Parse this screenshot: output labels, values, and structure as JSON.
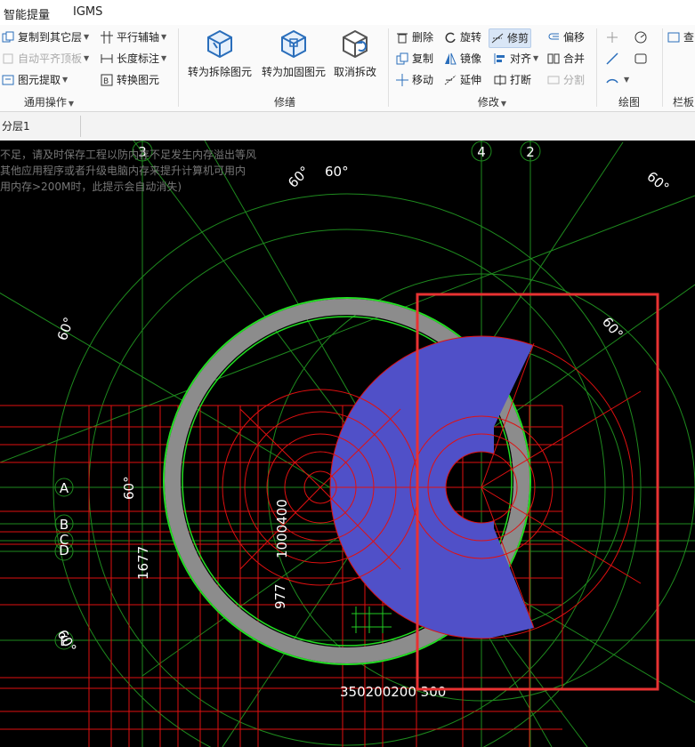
{
  "menubar": {
    "items": [
      "智能提量",
      "IGMS"
    ]
  },
  "ribbon": {
    "general": {
      "copy_to_layer": "复制到其它层",
      "auto_align_top": "自动平齐顶板",
      "element_extract": "图元提取",
      "parallel_axis": "平行辅轴",
      "length_annotation": "长度标注",
      "convert_element": "转换图元",
      "group_label": "通用操作"
    },
    "repair": {
      "to_split_element": "转为拆除图元",
      "to_reinforce_element": "转为加固图元",
      "cancel_split": "取消拆改",
      "group_label": "修缮"
    },
    "modify": {
      "delete": "删除",
      "rotate": "旋转",
      "trim": "修剪",
      "offset": "偏移",
      "copy": "复制",
      "mirror": "镜像",
      "align": "对齐",
      "merge": "合并",
      "move": "移动",
      "extend": "延伸",
      "break": "打断",
      "split": "分割",
      "group_label": "修改"
    },
    "draw": {
      "group_label": "绘图"
    },
    "panel": {
      "label": "栏板",
      "query_label": "查"
    }
  },
  "layer": {
    "current": "分层1"
  },
  "canvas": {
    "warning_lines": [
      "不足，请及时保存工程以防内存不足发生内存溢出等风",
      "其他应用程序或者升级电脑内存来提升计算机可用内",
      "用内存>200M时，此提示会自动消失)"
    ],
    "axis_labels": [
      "3",
      "4",
      "2",
      "A",
      "B",
      "C",
      "D",
      "E"
    ],
    "angle_labels": [
      "60°",
      "60°",
      "60°",
      "60°",
      "60°",
      "60°",
      "60°"
    ],
    "dimension_labels": [
      "1000400",
      "1677",
      "977",
      "350200200 300"
    ],
    "colors": {
      "background": "#000000",
      "grid": "#1e8a1e",
      "red_lines": "#e01010",
      "ring_fill": "#8c8c8c",
      "ring_edge": "#22dd22",
      "slab": "#5050c8",
      "selection": "#e83232"
    }
  }
}
